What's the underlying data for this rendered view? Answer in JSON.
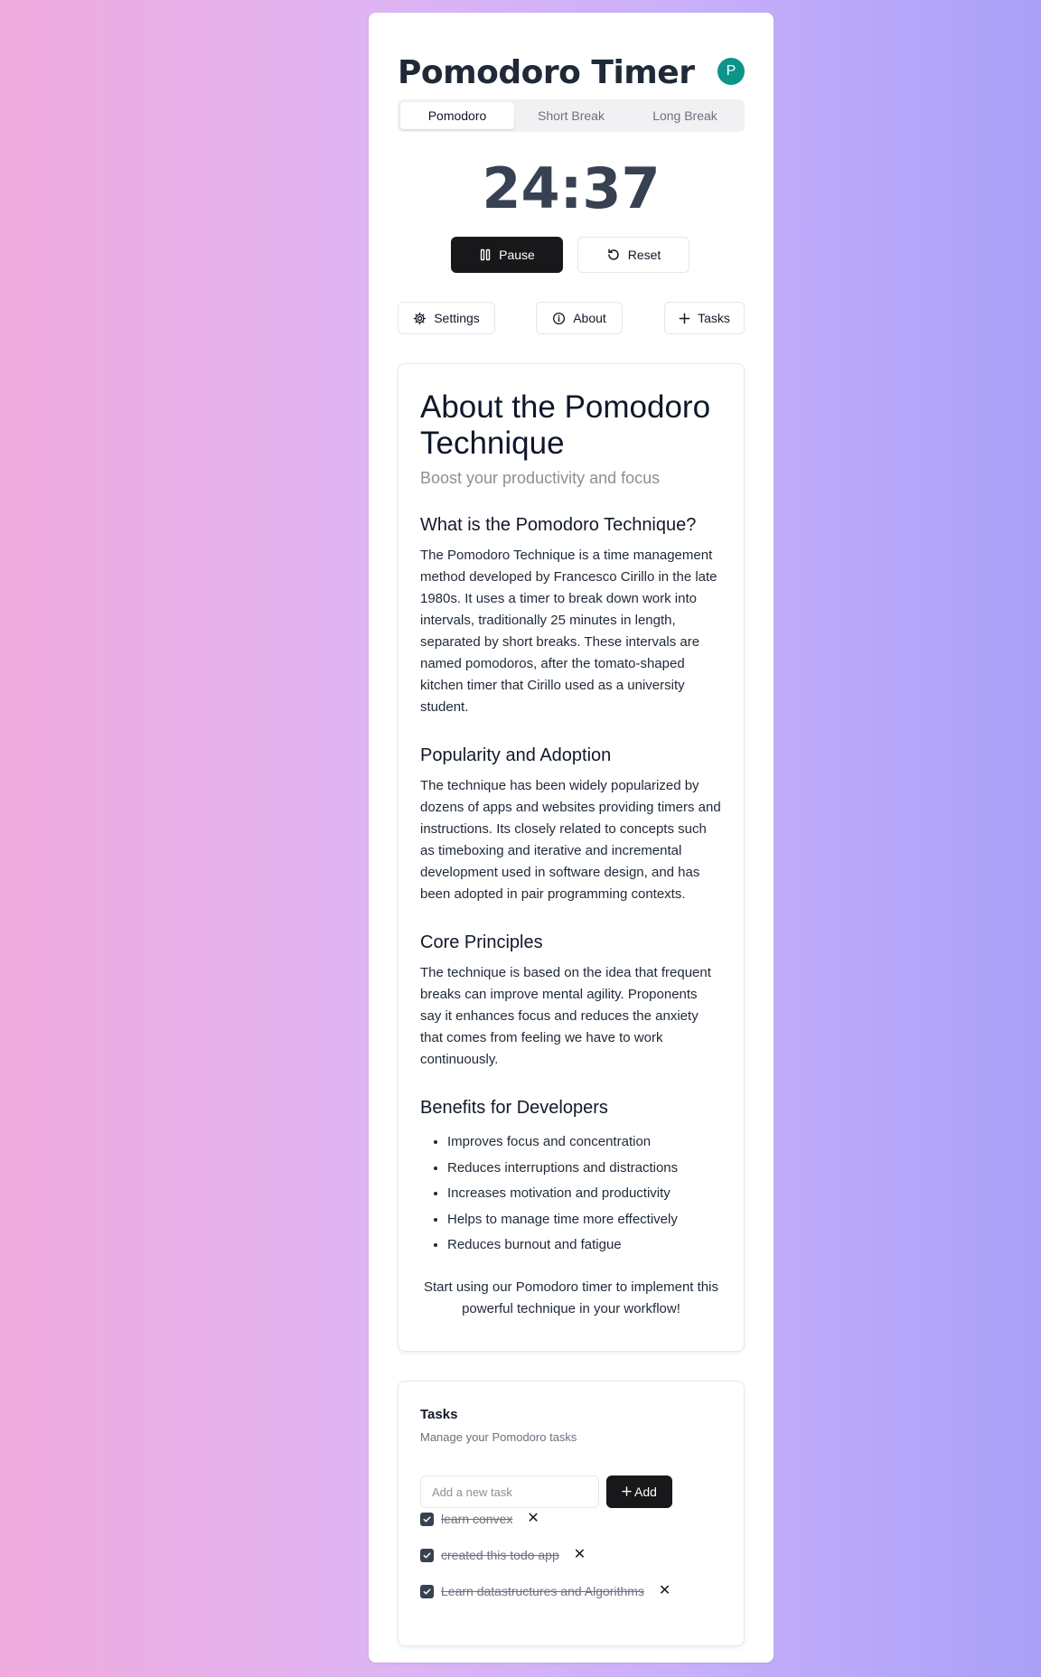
{
  "app": {
    "title": "Pomodoro Timer",
    "avatar_letter": "P"
  },
  "modes": [
    {
      "label": "Pomodoro",
      "active": true
    },
    {
      "label": "Short Break",
      "active": false
    },
    {
      "label": "Long Break",
      "active": false
    }
  ],
  "timer": {
    "display": "24:37"
  },
  "controls": {
    "pause_label": "Pause",
    "reset_label": "Reset"
  },
  "utility": {
    "settings_label": "Settings",
    "about_label": "About",
    "tasks_label": "Tasks"
  },
  "about": {
    "title": "About the Pomodoro Technique",
    "subtitle": "Boost your productivity and focus",
    "sections": [
      {
        "heading": "What is the Pomodoro Technique?",
        "body": "The Pomodoro Technique is a time management method developed by Francesco Cirillo in the late 1980s. It uses a timer to break down work into intervals, traditionally 25 minutes in length, separated by short breaks. These intervals are named pomodoros, after the tomato-shaped kitchen timer that Cirillo used as a university student."
      },
      {
        "heading": "Popularity and Adoption",
        "body": "The technique has been widely popularized by dozens of apps and websites providing timers and instructions. Its closely related to concepts such as timeboxing and iterative and incremental development used in software design, and has been adopted in pair programming contexts."
      },
      {
        "heading": "Core Principles",
        "body": "The technique is based on the idea that frequent breaks can improve mental agility. Proponents say it enhances focus and reduces the anxiety that comes from feeling we have to work continuously."
      }
    ],
    "benefits_heading": "Benefits for Developers",
    "benefits": [
      "Improves focus and concentration",
      "Reduces interruptions and distractions",
      "Increases motivation and productivity",
      "Helps to manage time more effectively",
      "Reduces burnout and fatigue"
    ],
    "footer": "Start using our Pomodoro timer to implement this powerful technique in your workflow!"
  },
  "tasks": {
    "title": "Tasks",
    "subtitle": "Manage your Pomodoro tasks",
    "input_placeholder": "Add a new task",
    "input_value": "",
    "add_label": "Add",
    "items": [
      {
        "text": "learn convex",
        "done": true
      },
      {
        "text": "created this todo app",
        "done": true
      },
      {
        "text": "Learn datastructures and Algorithms",
        "done": true
      }
    ]
  },
  "colors": {
    "accent_dark": "#18181b",
    "avatar_bg": "#0d9488",
    "bg_gradient_left": "#f0abde",
    "bg_gradient_right": "#a9a0f8"
  }
}
